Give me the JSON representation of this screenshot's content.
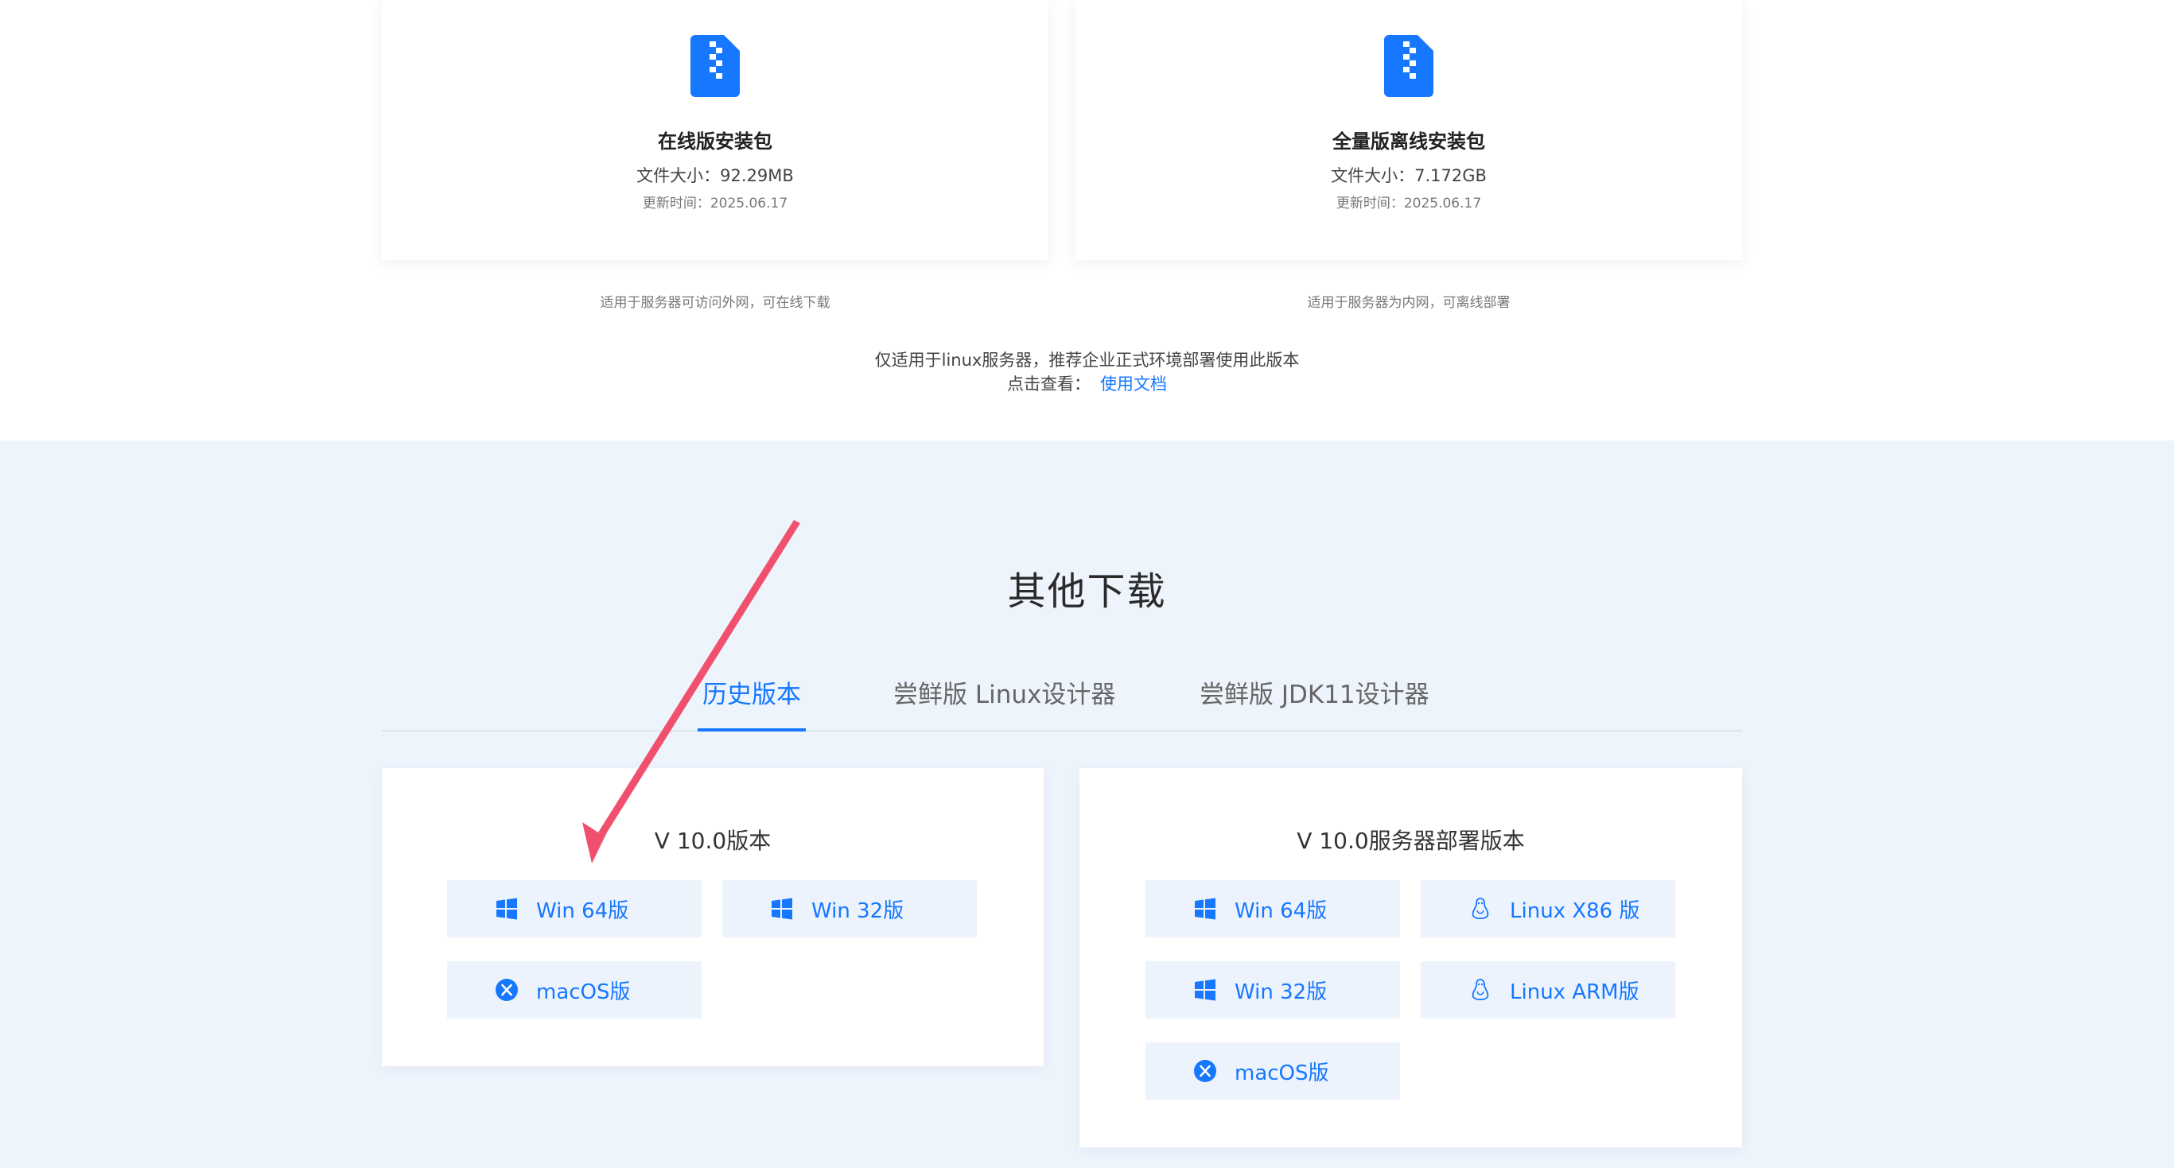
{
  "packages": [
    {
      "title": "在线版安装包",
      "size": "文件大小：92.29MB",
      "updated": "更新时间：2025.06.17",
      "note": "适用于服务器可访问外网，可在线下载",
      "icon": "zip-file-icon"
    },
    {
      "title": "全量版离线安装包",
      "size": "文件大小：7.172GB",
      "updated": "更新时间：2025.06.17",
      "note": "适用于服务器为内网，可离线部署",
      "icon": "zip-file-icon"
    }
  ],
  "linux_note": "仅适用于linux服务器，推荐企业正式环境部署使用此版本",
  "doc_prefix": "点击查看：",
  "doc_link": "使用文档",
  "section_title": "其他下载",
  "tabs": [
    {
      "label": "历史版本",
      "active": true
    },
    {
      "label": "尝鲜版 Linux设计器",
      "active": false
    },
    {
      "label": "尝鲜版 JDK11设计器",
      "active": false
    }
  ],
  "desktop_card": {
    "title": "V 10.0版本",
    "buttons": [
      {
        "label": "Win 64版",
        "icon": "windows-icon"
      },
      {
        "label": "Win 32版",
        "icon": "windows-icon"
      },
      {
        "label": "macOS版",
        "icon": "macos-icon"
      }
    ]
  },
  "server_card": {
    "title": "V 10.0服务器部署版本",
    "buttons": [
      {
        "label": "Win 64版",
        "icon": "windows-icon"
      },
      {
        "label": "Linux X86 版",
        "icon": "linux-icon"
      },
      {
        "label": "Win 32版",
        "icon": "windows-icon"
      },
      {
        "label": "Linux ARM版",
        "icon": "linux-icon"
      },
      {
        "label": "macOS版",
        "icon": "macos-icon"
      }
    ]
  },
  "colors": {
    "accent": "#1677ff",
    "section_bg": "#eef4fc",
    "button_bg": "#edf3fc",
    "annotation_arrow": "#f0506e"
  }
}
